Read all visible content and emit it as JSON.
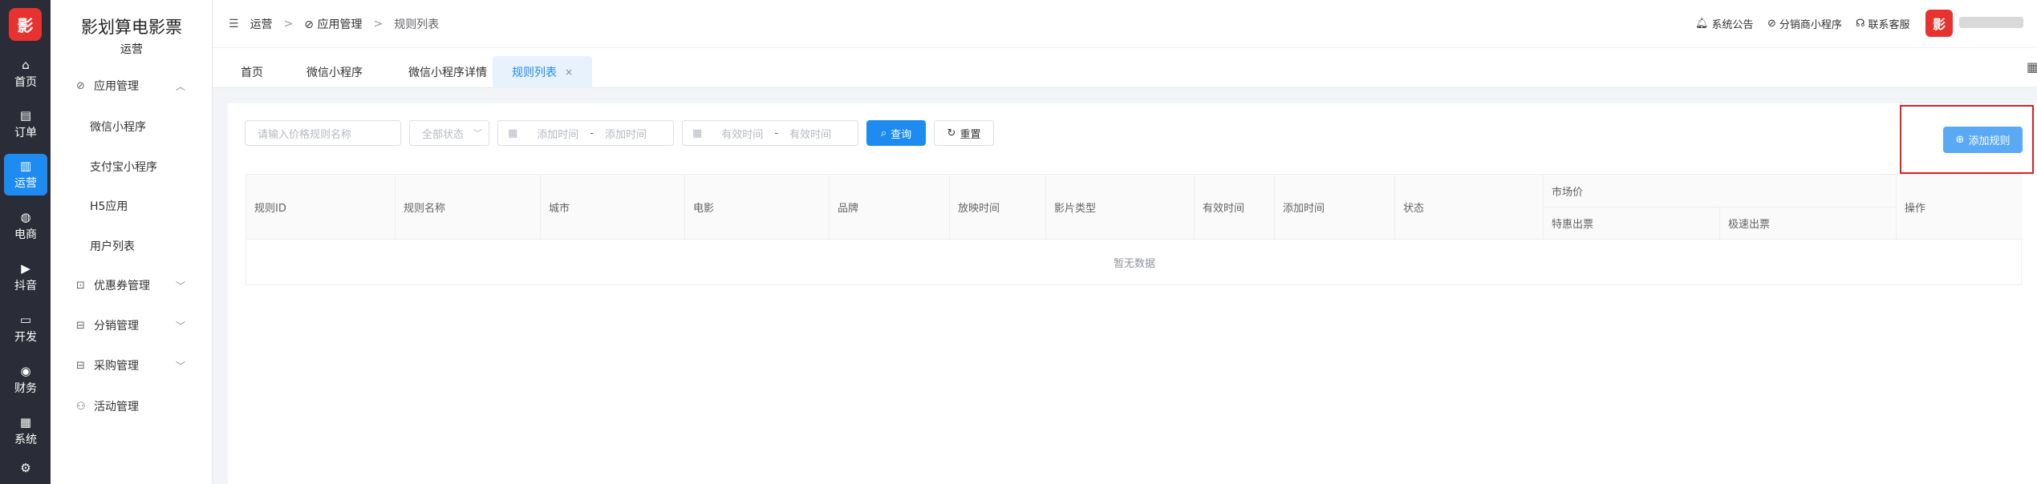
{
  "rail": {
    "logo": "影",
    "items": [
      {
        "label": "首页",
        "icon": "⌂"
      },
      {
        "label": "订单",
        "icon": "▤"
      },
      {
        "label": "运营",
        "icon": "▥"
      },
      {
        "label": "电商",
        "icon": "◍"
      },
      {
        "label": "抖音",
        "icon": "▶"
      },
      {
        "label": "开发",
        "icon": "▭"
      },
      {
        "label": "财务",
        "icon": "◉"
      },
      {
        "label": "系统",
        "icon": "▦"
      },
      {
        "label": "",
        "icon": "⚙"
      }
    ]
  },
  "menu": {
    "brand": "影划算电影票",
    "subtitle": "运营",
    "app_mgmt": "应用管理",
    "wechat_mini": "微信小程序",
    "alipay_mini": "支付宝小程序",
    "h5": "H5应用",
    "users": "用户列表",
    "coupon_mgmt": "优惠券管理",
    "distribution_mgmt": "分销管理",
    "purchase_mgmt": "采购管理",
    "activity_mgmt": "活动管理"
  },
  "topbar": {
    "crumb1": "运营",
    "crumb2": "应用管理",
    "crumb3": "规则列表",
    "notice": "系统公告",
    "distributor": "分销商小程序",
    "support": "联系客服",
    "avatar": "影"
  },
  "tabs": {
    "home": "首页",
    "wechat": "微信小程序",
    "wechat_detail": "微信小程序详情",
    "rules": "规则列表",
    "close": "×"
  },
  "filters": {
    "name_placeholder": "请输入价格规则名称",
    "status": "全部状态",
    "add_from": "添加时间",
    "add_to": "添加时间",
    "valid_from": "有效时间",
    "valid_to": "有效时间",
    "dash": "-",
    "query": "查询",
    "reset": "重置",
    "add_rule": "添加规则"
  },
  "table": {
    "col_id": "规则ID",
    "col_name": "规则名称",
    "col_city": "城市",
    "col_movie": "电影",
    "col_brand": "品牌",
    "col_showtime": "放映时间",
    "col_type": "影片类型",
    "col_valid": "有效时间",
    "col_added": "添加时间",
    "col_status": "状态",
    "col_market": "市场价",
    "col_special": "特惠出票",
    "col_fast": "极速出票",
    "col_action": "操作",
    "empty": "暂无数据"
  },
  "colors": {
    "accent": "#1e8bf0",
    "rail_bg": "#2a2d37",
    "highlight": "#e02020"
  }
}
